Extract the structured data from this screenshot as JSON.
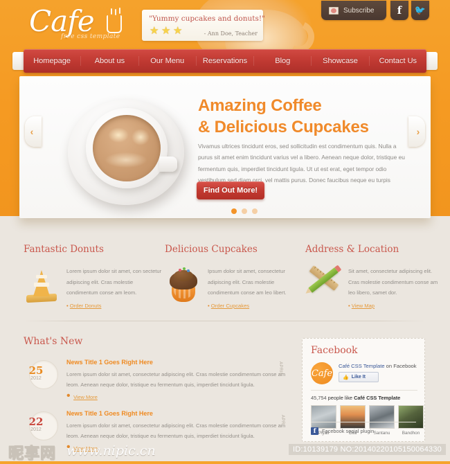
{
  "site": {
    "logo_text": "Cafe",
    "logo_sub": "free css template"
  },
  "testimonial": {
    "quote": "\"Yummy cupcakes and donuts!\"",
    "author": "- Ann Doe, Teacher",
    "stars": 3
  },
  "topbar": {
    "subscribe_label": "Subscribe",
    "facebook_glyph": "f",
    "twitter_glyph": "✈"
  },
  "nav": {
    "items": [
      {
        "label": "Homepage"
      },
      {
        "label": "About us"
      },
      {
        "label": "Our Menu"
      },
      {
        "label": "Reservations"
      },
      {
        "label": "Blog"
      },
      {
        "label": "Showcase"
      },
      {
        "label": "Contact Us"
      }
    ]
  },
  "hero": {
    "title_line1": "Amazing Coffee",
    "title_line2": "& Delicious Cupcakes",
    "paragraph": "Vivamus ultrices tincidunt eros, sed sollicitudin est condimentum quis. Nulla a purus sit amet enim tincidunt varius vel a libero. Aenean neque dolor, tristique eu fermentum quis, imperdiet tincidunt ligula. Ut ut est erat, eget tempor odio vestibulum sed diam orci, vel mattis purus. Donec faucibus neque eu turpis imperdiet commodo.",
    "button_label": "Find Out More!",
    "prev_glyph": "‹",
    "next_glyph": "›",
    "dots": 3,
    "active_dot": 0
  },
  "features": [
    {
      "title": "Fantastic Donuts",
      "text": "Lorem ipsum dolor sit amet, con sectetur adipiscing elit. Cras molestie condimentum conse am leom.",
      "link": "Order Donuts",
      "icon": "traffic-cone-icon"
    },
    {
      "title": "Delicious Cupcakes",
      "text": "Ipsum dolor sit amet, consectetur adipiscing elit. Cras molestie condimentum conse am leo libert.",
      "link": "Order Cupcakes",
      "icon": "cupcake-icon"
    },
    {
      "title": "Address & Location",
      "text": "Sit amet, consectetur adipiscing elit. Cras molestie condimentum conse am leo libero, samet dor.",
      "link": "View Map",
      "icon": "ruler-pencil-icon"
    }
  ],
  "whats_new": {
    "heading": "What's New",
    "items": [
      {
        "day": "25",
        "month": "APRIL",
        "year": "2012",
        "day_color": "#e98b22",
        "title": "News Title 1 Goes Right Here",
        "text": "Lorem ipsum dolor sit amet, consectetur adipiscing elit. Cras molestie condimentum conse am leom. Aenean neque dolor, tristique eu fermentum quis, imperdiet tincidunt ligula.",
        "link": "View More"
      },
      {
        "day": "22",
        "month": "APR",
        "year": "2012",
        "day_color": "#c9463c",
        "title": "News Title 1 Goes Right Here",
        "text": "Lorem ipsum dolor sit amet, consectetur adipiscing elit. Cras molestie condimentum conse am leom. Aenean neque dolor, tristique eu fermentum quis, imperdiet tincidunt ligula.",
        "link": "View More"
      }
    ]
  },
  "facebook": {
    "title": "Facebook",
    "avatar_text": "Cafe",
    "page_name": "Café CSS Template",
    "page_suffix": " on Facebook",
    "like_label": "Like It",
    "count_number": "45,754",
    "count_mid": "people like ",
    "count_page": "Café CSS Template",
    "faces": [
      {
        "name": "Piyali"
      },
      {
        "name": "Dila"
      },
      {
        "name": "Santanu"
      },
      {
        "name": "Bandhon"
      }
    ],
    "plugin_label": "Facebook social plugin"
  },
  "watermark": {
    "logo": "昵享网",
    "url": "www.nipic.cn",
    "id_text": "ID:10139179 NO:20140220105150064330"
  },
  "colors": {
    "orange": "#f59a22",
    "red": "#c23a31",
    "heading_red": "#c9584d",
    "link_orange": "#e59a3c"
  }
}
